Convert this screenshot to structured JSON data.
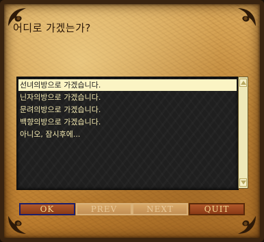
{
  "dialog": {
    "title": "어디로 가겠는가?"
  },
  "choices": [
    {
      "label": "선녀의방으로 가겠습니다.",
      "selected": true
    },
    {
      "label": "닌자의방으로 가겠습니다.",
      "selected": false
    },
    {
      "label": "문려의방으로 가겠습니다.",
      "selected": false
    },
    {
      "label": "백향의방으로 가겠습니다.",
      "selected": false
    },
    {
      "label": "아니오, 잠시후에...",
      "selected": false
    }
  ],
  "buttons": {
    "ok": "OK",
    "prev": "PREV",
    "next": "NEXT",
    "quit": "QUIT"
  },
  "colors": {
    "parchment": "#c98f3e",
    "list_bg": "#1f1f1f",
    "item_text": "#f2e8b0",
    "selected_bg": "#fbf4c4",
    "button_active": "#8a3a16",
    "ok_border": "#1b1e6a"
  }
}
